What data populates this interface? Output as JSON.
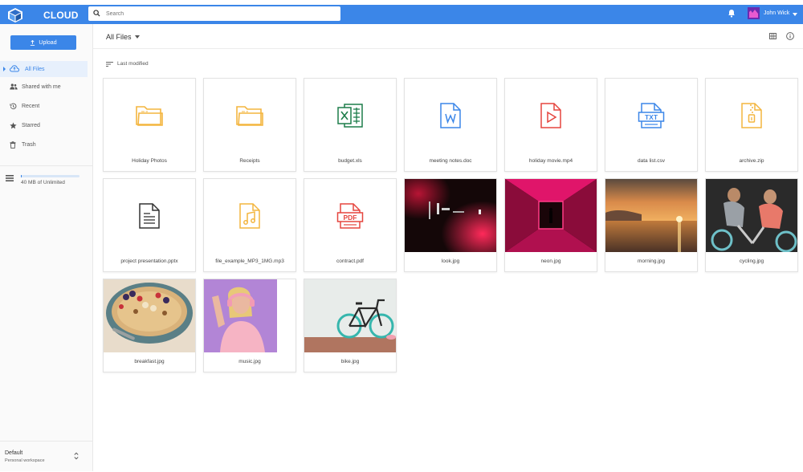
{
  "header": {
    "logo_text": "CLOUD",
    "search_placeholder": "Search",
    "user_name": "John Wick"
  },
  "sidebar": {
    "upload_label": "Upload",
    "items": [
      {
        "label": "All Files",
        "icon": "cloud-icon"
      },
      {
        "label": "Shared with me",
        "icon": "people-icon"
      },
      {
        "label": "Recent",
        "icon": "history-icon"
      },
      {
        "label": "Starred",
        "icon": "star-icon"
      },
      {
        "label": "Trash",
        "icon": "trash-icon"
      }
    ],
    "storage_text": "40 MB of Unlimited",
    "storage_fraction": 0.02,
    "workspace_name": "Default",
    "workspace_sub": "Personal workspace"
  },
  "main": {
    "title": "All Files",
    "sort_label": "Last modified",
    "files": [
      {
        "name": "Holiday Photos",
        "type": "folder"
      },
      {
        "name": "Receipts",
        "type": "folder"
      },
      {
        "name": "budget.xls",
        "type": "xls"
      },
      {
        "name": "meeting notes.doc",
        "type": "doc"
      },
      {
        "name": "holiday movie.mp4",
        "type": "video"
      },
      {
        "name": "data list.csv",
        "type": "txt"
      },
      {
        "name": "archive.zip",
        "type": "zip"
      },
      {
        "name": "project presentation.pptx",
        "type": "ppt"
      },
      {
        "name": "file_example_MP3_1MG.mp3",
        "type": "audio"
      },
      {
        "name": "contract.pdf",
        "type": "pdf"
      },
      {
        "name": "look.jpg",
        "type": "image"
      },
      {
        "name": "neon.jpg",
        "type": "image"
      },
      {
        "name": "morning.jpg",
        "type": "image"
      },
      {
        "name": "cycling.jpg",
        "type": "image"
      },
      {
        "name": "breakfast.jpg",
        "type": "image"
      },
      {
        "name": "music.jpg",
        "type": "image"
      },
      {
        "name": "bike.jpg",
        "type": "image"
      }
    ]
  },
  "colors": {
    "brand": "#3b86e8",
    "folder": "#f3b53f",
    "xls": "#1d7d4a",
    "doc": "#3b86e8",
    "video": "#e5453e",
    "txt": "#3b86e8",
    "zip": "#f3b53f",
    "ppt": "#333333",
    "audio": "#f3b53f",
    "pdf": "#e5453e"
  }
}
